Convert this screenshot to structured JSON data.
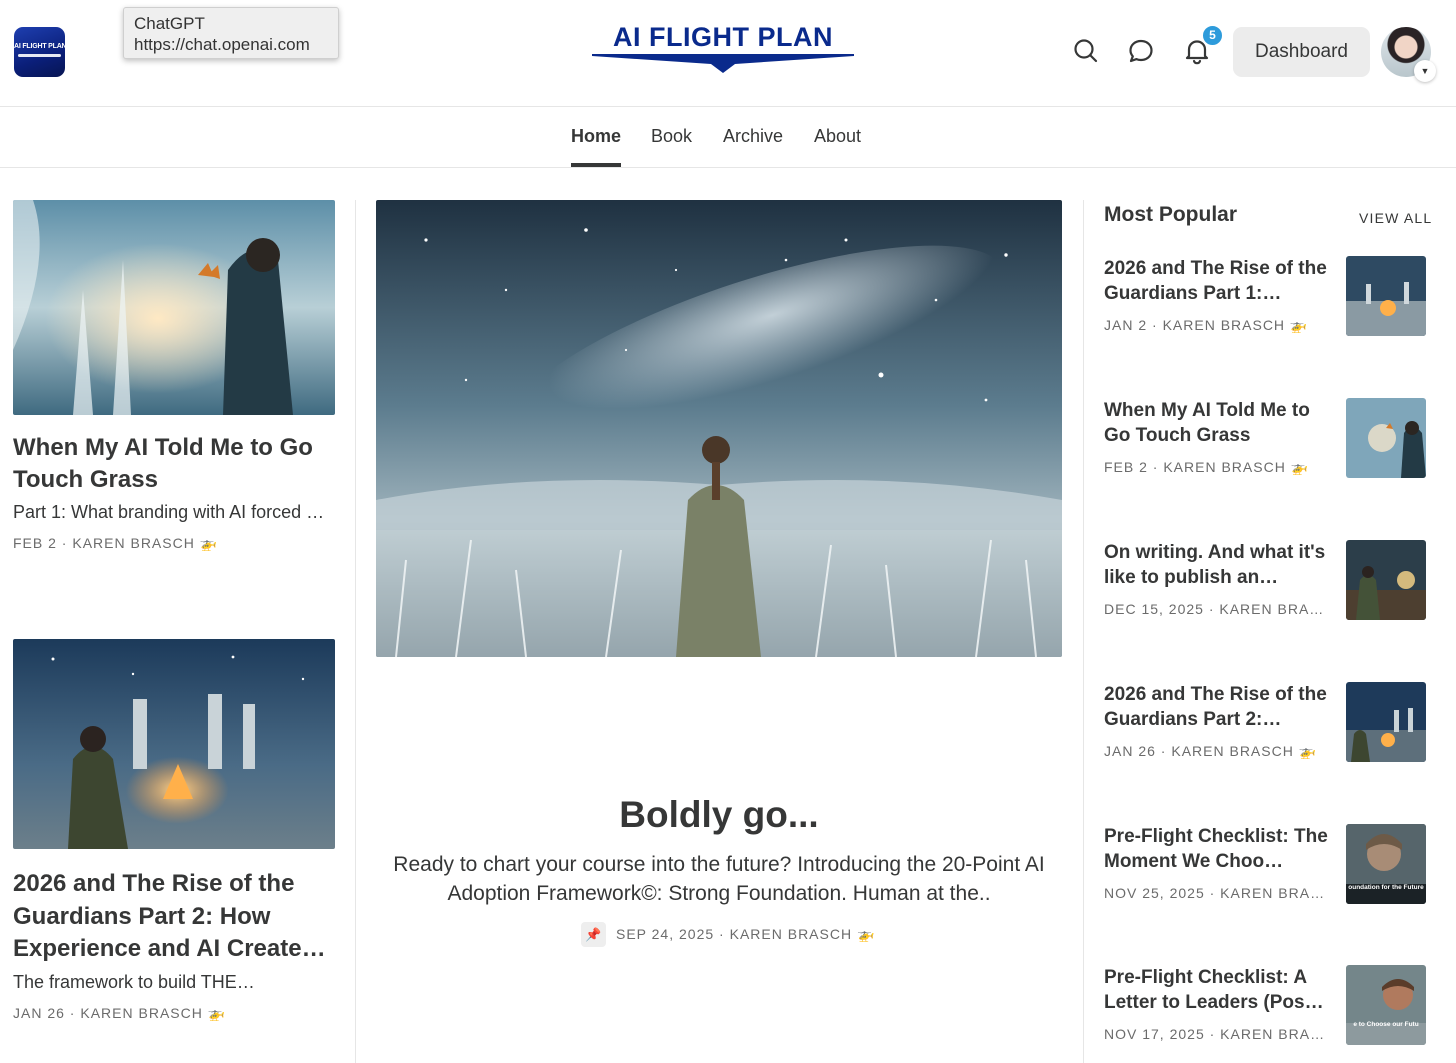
{
  "tooltip": {
    "title": "ChatGPT",
    "url": "https://chat.openai.com"
  },
  "header": {
    "app_icon_text": "AI FLIGHT PLAN",
    "logo_text": "AI FLIGHT PLAN",
    "notification_count": "5",
    "dashboard_label": "Dashboard",
    "icons": [
      "search-icon",
      "chat-icon",
      "bell-icon",
      "avatar",
      "chevron-down-icon"
    ]
  },
  "nav": {
    "tabs": [
      {
        "label": "Home",
        "active": true
      },
      {
        "label": "Book"
      },
      {
        "label": "Archive"
      },
      {
        "label": "About"
      }
    ]
  },
  "left_posts": [
    {
      "title": "When My AI Told Me to Go Touch Grass",
      "subtitle": "Part 1: What branding with AI forced …",
      "date": "FEB 2",
      "author": "KAREN BRASCH 🚁"
    },
    {
      "title": "2026 and The Rise of the Guardians Part 2: How Experience and AI Create…",
      "subtitle": "The framework to build THE…",
      "date": "JAN 26",
      "author": "KAREN BRASCH 🚁"
    }
  ],
  "featured": {
    "title": "Boldly go...",
    "subtitle": "Ready to chart your course into the future? Introducing the 20-Point AI Adoption Framework©: Strong Foundation. Human at the..",
    "date": "SEP 24, 2025",
    "author": "KAREN BRASCH 🚁",
    "pin_icon": "pin-icon"
  },
  "popular": {
    "heading": "Most Popular",
    "view_all": "VIEW ALL",
    "items": [
      {
        "title": "2026 and The Rise of the Guardians Part 1:…",
        "meta": "JAN 2 · KAREN BRASCH 🚁"
      },
      {
        "title": "When My AI Told Me to Go Touch Grass",
        "meta": "FEB 2 · KAREN BRASCH 🚁"
      },
      {
        "title": "On writing. And what it's like to publish an…",
        "meta": "DEC 15, 2025 · KAREN BRASC…"
      },
      {
        "title": "2026 and The Rise of the Guardians Part 2:…",
        "meta": "JAN 26 · KAREN BRASCH 🚁"
      },
      {
        "title": "Pre-Flight Checklist: The Moment We Choo…",
        "meta": "NOV 25, 2025 · KAREN BRASC…",
        "thumb_caption": "oundation for the Future"
      },
      {
        "title": "Pre-Flight Checklist: A Letter to Leaders (Pos…",
        "meta": "NOV 17, 2025 · KAREN BRASC…",
        "thumb_caption": "e to Choose our Futu"
      }
    ]
  },
  "colors": {
    "brand_blue": "#0a2a8c",
    "badge_blue": "#2d9bdb",
    "text": "#363737",
    "meta_text": "#6b6b6b"
  }
}
